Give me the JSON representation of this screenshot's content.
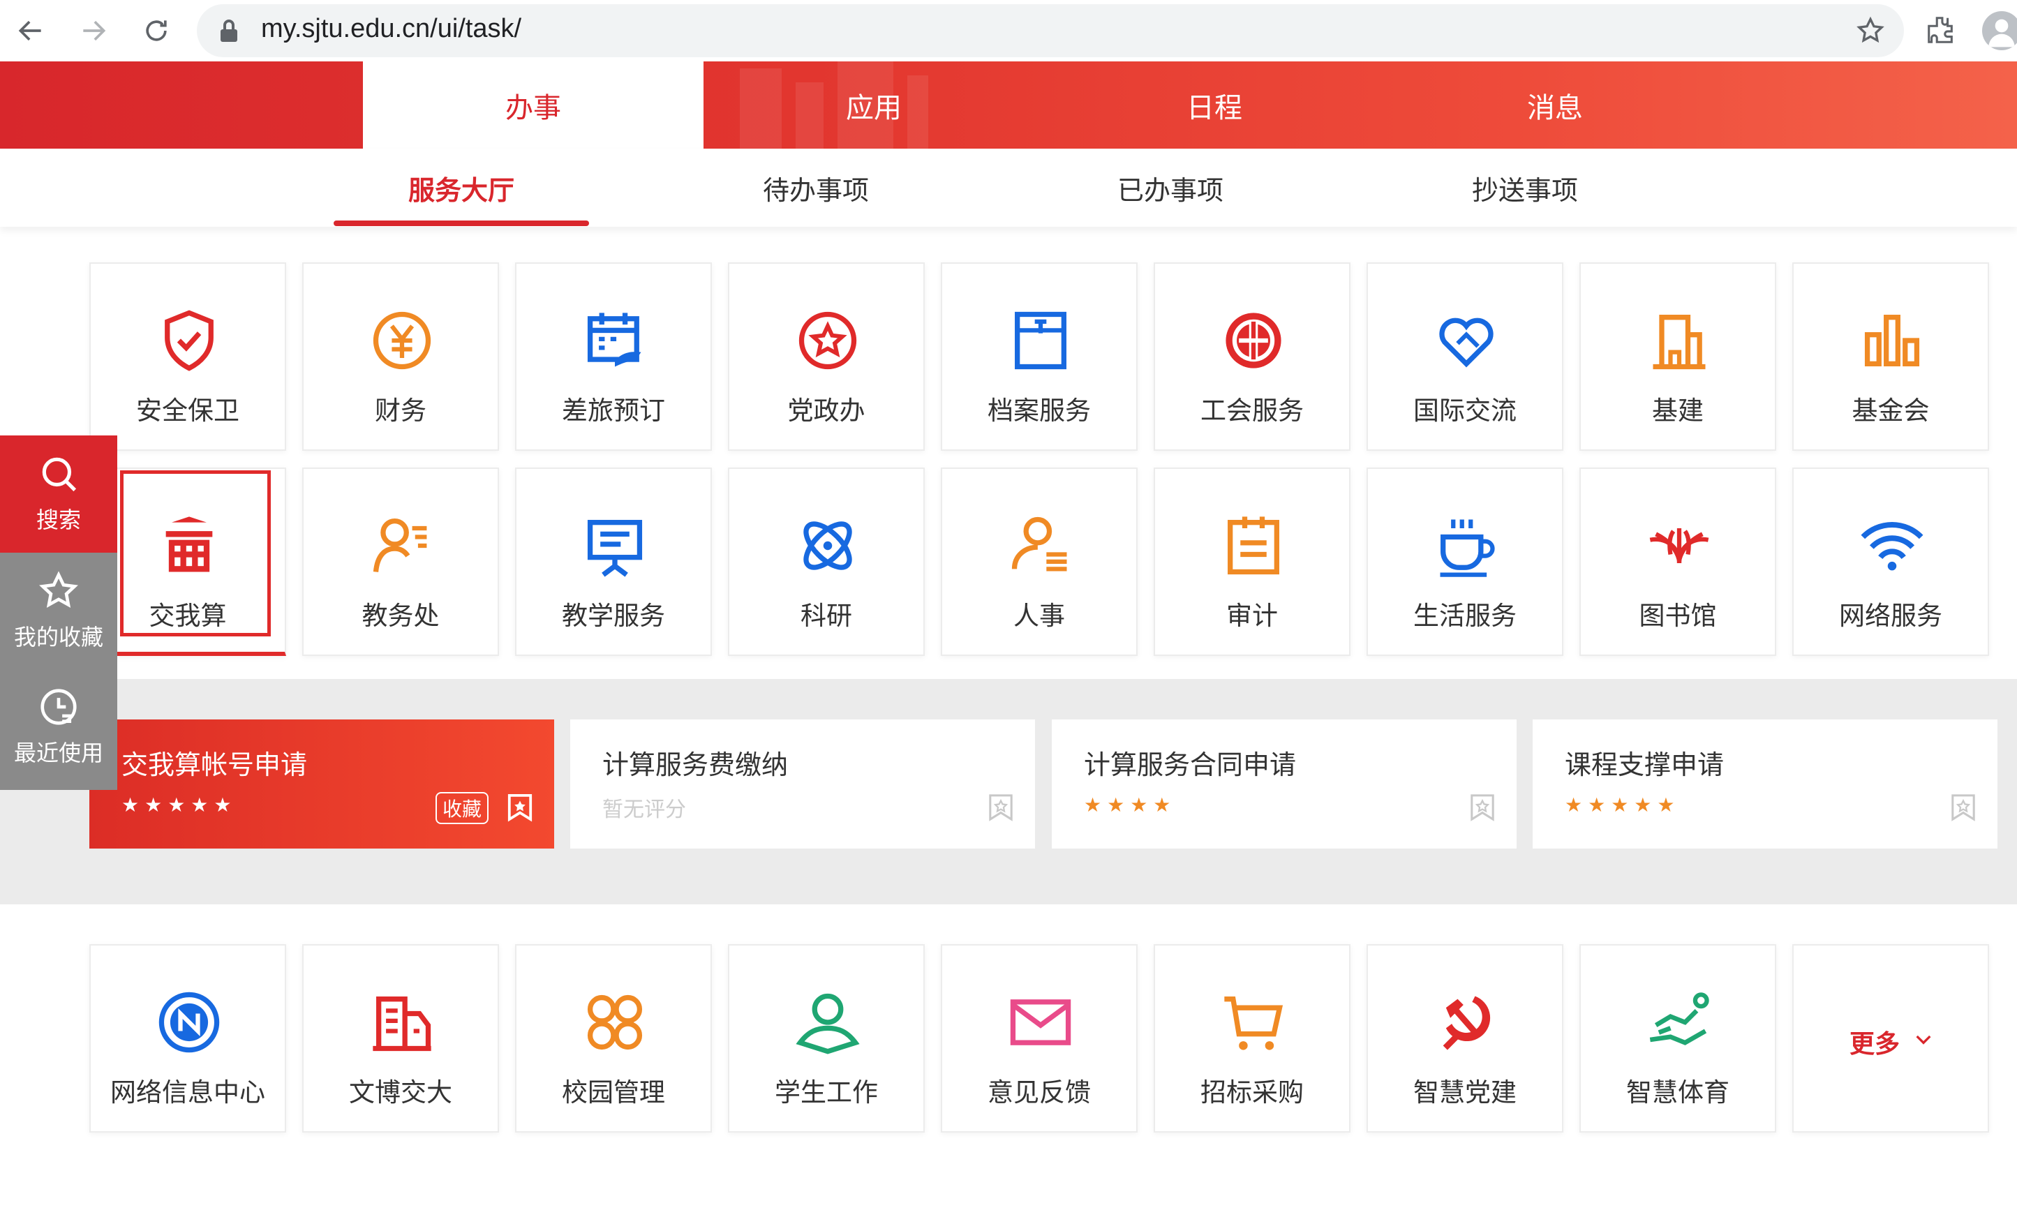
{
  "browser": {
    "url": "my.sjtu.edu.cn/ui/task/"
  },
  "main_tabs": [
    {
      "label": "办事",
      "active": true
    },
    {
      "label": "应用",
      "active": false
    },
    {
      "label": "日程",
      "active": false
    },
    {
      "label": "消息",
      "active": false
    }
  ],
  "sub_tabs": [
    {
      "label": "服务大厅",
      "active": true
    },
    {
      "label": "待办事项",
      "active": false
    },
    {
      "label": "已办事项",
      "active": false
    },
    {
      "label": "抄送事项",
      "active": false
    }
  ],
  "float_menu": [
    {
      "label": "搜索",
      "icon": "search-icon"
    },
    {
      "label": "我的收藏",
      "icon": "star-icon"
    },
    {
      "label": "最近使用",
      "icon": "clock-icon"
    }
  ],
  "categories_row1": [
    {
      "label": "安全保卫",
      "icon": "shield-icon"
    },
    {
      "label": "财务",
      "icon": "yuan-icon"
    },
    {
      "label": "差旅预订",
      "icon": "calendar-icon"
    },
    {
      "label": "党政办",
      "icon": "star-circle-icon"
    },
    {
      "label": "档案服务",
      "icon": "archive-icon"
    },
    {
      "label": "工会服务",
      "icon": "union-icon"
    },
    {
      "label": "国际交流",
      "icon": "handshake-heart-icon"
    },
    {
      "label": "基建",
      "icon": "building-icon"
    },
    {
      "label": "基金会",
      "icon": "bar-chart-icon"
    }
  ],
  "categories_row2": [
    {
      "label": "交我算",
      "icon": "compute-icon",
      "selected": true
    },
    {
      "label": "教务处",
      "icon": "teacher-icon"
    },
    {
      "label": "教学服务",
      "icon": "presentation-icon"
    },
    {
      "label": "科研",
      "icon": "atom-icon"
    },
    {
      "label": "人事",
      "icon": "person-list-icon"
    },
    {
      "label": "审计",
      "icon": "clipboard-icon"
    },
    {
      "label": "生活服务",
      "icon": "coffee-icon"
    },
    {
      "label": "图书馆",
      "icon": "library-icon"
    },
    {
      "label": "网络服务",
      "icon": "wifi-icon"
    }
  ],
  "services": [
    {
      "title": "交我算帐号申请",
      "stars": "★★★★★",
      "collect_label": "收藏",
      "highlight": true
    },
    {
      "title": "计算服务费缴纳",
      "rating_text": "暂无评分"
    },
    {
      "title": "计算服务合同申请",
      "stars": "★★★★"
    },
    {
      "title": "课程支撑申请",
      "stars": "★★★★★"
    }
  ],
  "categories_row3": [
    {
      "label": "网络信息中心",
      "icon": "network-center-icon"
    },
    {
      "label": "文博交大",
      "icon": "museum-icon"
    },
    {
      "label": "校园管理",
      "icon": "grid-icon"
    },
    {
      "label": "学生工作",
      "icon": "student-icon"
    },
    {
      "label": "意见反馈",
      "icon": "mail-icon"
    },
    {
      "label": "招标采购",
      "icon": "cart-icon"
    },
    {
      "label": "智慧党建",
      "icon": "party-emblem-icon"
    },
    {
      "label": "智慧体育",
      "icon": "runner-icon"
    }
  ],
  "more_label": "更多",
  "colors": {
    "brand_red": "#d9262c",
    "orange": "#f08a24",
    "blue": "#1769e0"
  }
}
